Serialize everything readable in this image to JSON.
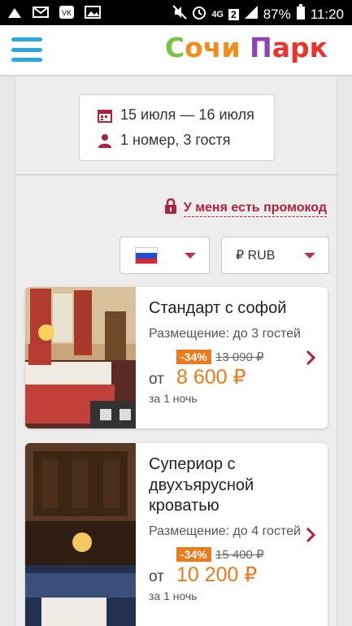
{
  "status_bar": {
    "battery": "87%",
    "time": "11:20",
    "network": "4G",
    "sim": "2"
  },
  "header": {
    "logo_parts": [
      "С",
      "очи",
      " ",
      "П",
      "арк"
    ]
  },
  "booking": {
    "dates": "15 июля — 16 июля",
    "guests": "1 номер, 3 гостя"
  },
  "promo": {
    "label": "У меня есть промокод"
  },
  "selectors": {
    "currency": "₽ RUB"
  },
  "rooms": [
    {
      "title": "Стандарт с софой",
      "capacity": "Размещение: до 3 гостей",
      "discount": "-34%",
      "old_price": "13 090 ₽",
      "from": "от",
      "price": "8 600 ₽",
      "per_night": "за 1 ночь"
    },
    {
      "title": "Суперior с двухъярусной кроватью",
      "capacity": "Размещение: до 4 гостей",
      "discount": "-34%",
      "old_price": "15 400 ₽",
      "from": "от",
      "price": "10 200 ₽",
      "per_night": "за 1 ночь"
    }
  ],
  "colors": {
    "accent_blue": "#29a9e0",
    "accent_red": "#b0213b",
    "price_orange": "#ee7b1b"
  },
  "icons": {
    "menu": "hamburger-menu-icon",
    "calendar": "calendar-icon",
    "user": "user-icon",
    "lock": "lock-icon",
    "flag": "russia-flag-icon",
    "caret": "caret-down-icon",
    "chevron": "chevron-right-icon"
  }
}
